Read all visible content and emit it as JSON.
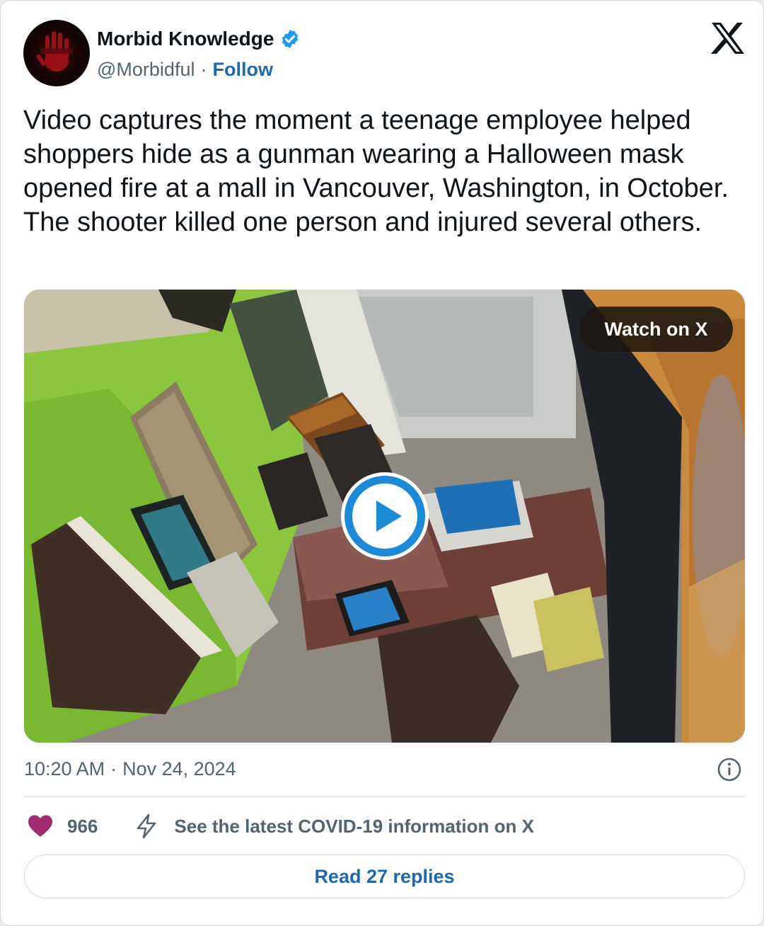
{
  "author": {
    "display_name": "Morbid Knowledge",
    "handle": "@Morbidful",
    "separator": "·",
    "follow_label": "Follow",
    "verified": true,
    "avatar_icon": "red-handprint-avatar-icon"
  },
  "platform_icon": "x-logo-icon",
  "tweet": {
    "text": "Video captures the moment a teenage employee helped shoppers hide as a gunman wearing a Halloween mask opened fire at a mall in Vancouver, Washington, in October. The shooter killed one person and injured several others."
  },
  "media": {
    "type": "video",
    "watch_label": "Watch on X",
    "play_icon": "play-icon"
  },
  "meta": {
    "time": "10:20 AM",
    "separator": "·",
    "date": "Nov 24, 2024"
  },
  "actions": {
    "like_count": "966",
    "covid_link": "See the latest COVID-19 information on X"
  },
  "replies_button": "Read 27 replies",
  "colors": {
    "link_blue": "#1d68b0",
    "verified_blue": "#1d9bf0",
    "heart": "#9e2c6e",
    "text_primary": "#0f1419",
    "text_secondary": "#536471"
  }
}
